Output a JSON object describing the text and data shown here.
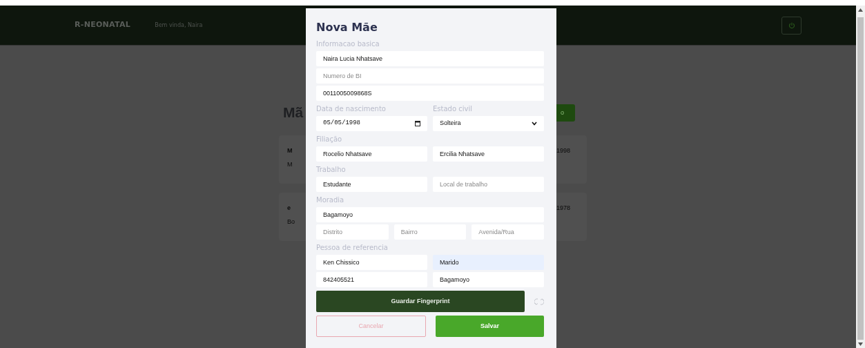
{
  "navbar": {
    "brand": "R-NEONATAL",
    "greeting": "Bem vinda, Naira"
  },
  "background": {
    "heading": "Mã",
    "button_fragment": "o",
    "cards": [
      {
        "left_lines": [
          "M",
          "M"
        ],
        "right_text": "1998"
      },
      {
        "left_lines": [
          "e",
          "Bo"
        ],
        "right_text": "1978"
      }
    ]
  },
  "modal": {
    "title": "Nova Mãe",
    "sections": [
      {
        "label": "Informacao basica",
        "rows": [
          [
            {
              "kind": "text",
              "value": "Naira Lucia Nhatsave"
            }
          ],
          [
            {
              "kind": "text",
              "placeholder": "Numero de BI"
            }
          ],
          [
            {
              "kind": "text",
              "value": "0011005009868S"
            }
          ]
        ]
      },
      {
        "rows": [
          [
            {
              "kind": "date",
              "label": "Data de nascimento",
              "value": "05/05/1998"
            },
            {
              "kind": "select",
              "label": "Estado civil",
              "value": "Solteira"
            }
          ]
        ]
      },
      {
        "label": "Filiação",
        "rows": [
          [
            {
              "kind": "text",
              "value": "Rocelio Nhatsave"
            },
            {
              "kind": "text",
              "value": "Ercilia Nhatsave"
            }
          ]
        ]
      },
      {
        "label": "Trabalho",
        "rows": [
          [
            {
              "kind": "text",
              "value": "Estudante"
            },
            {
              "kind": "text",
              "placeholder": "Local de trabalho"
            }
          ]
        ]
      },
      {
        "label": "Moradia",
        "rows": [
          [
            {
              "kind": "text",
              "value": "Bagamoyo"
            }
          ],
          [
            {
              "kind": "text",
              "placeholder": "Distrito"
            },
            {
              "kind": "text",
              "placeholder": "Bairro"
            },
            {
              "kind": "text",
              "placeholder": "Avenida/Rua"
            }
          ]
        ]
      },
      {
        "label": "Pessoa de referencia",
        "rows": [
          [
            {
              "kind": "text",
              "value": "Ken Chissico"
            },
            {
              "kind": "text",
              "value": "Marido",
              "autofilled": true
            }
          ],
          [
            {
              "kind": "text",
              "value": "842405521"
            },
            {
              "kind": "text",
              "value": "Bagamoyo"
            }
          ]
        ]
      }
    ],
    "fingerprint_button": "Guardar Fingerprint",
    "cancel_button": "Cancelar",
    "save_button": "Salvar"
  }
}
